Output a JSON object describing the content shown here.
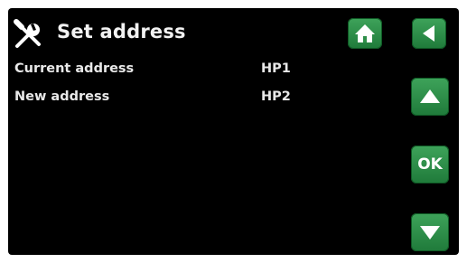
{
  "header": {
    "title": "Set address",
    "icon": "tools-icon"
  },
  "nav": {
    "home_icon": "home-icon",
    "back_icon": "back-arrow-icon"
  },
  "rows": [
    {
      "label": "Current address",
      "value": "HP1"
    },
    {
      "label": "New address",
      "value": "HP2"
    }
  ],
  "controls": {
    "up_icon": "up-arrow-icon",
    "ok_label": "OK",
    "down_icon": "down-arrow-icon"
  },
  "colors": {
    "background": "#000000",
    "button": "#2e8f48",
    "text": "#ffffff"
  }
}
